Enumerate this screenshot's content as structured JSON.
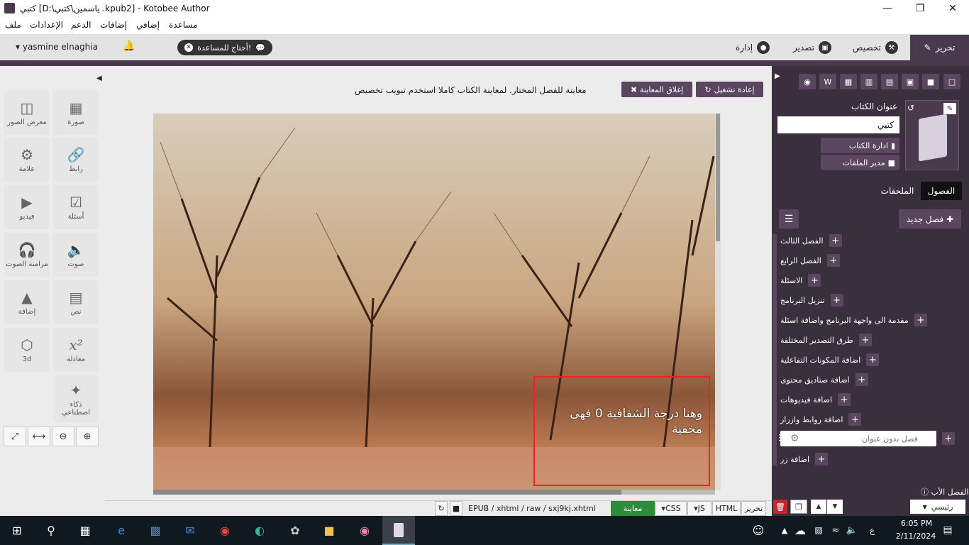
{
  "window": {
    "title": "كتبي [D:\\ياسمين\\كتبي .kpub2] - Kotobee Author"
  },
  "menu": [
    "ملف",
    "الإعدادات",
    "الدعم",
    "إضافات",
    "إضافي",
    "مساعدة"
  ],
  "header": {
    "user": "yasmine elnaghia",
    "help_button": "أحتاج للمساعدة!",
    "tabs": [
      "تحرير",
      "تخصيص",
      "تصدير",
      "إدارة"
    ]
  },
  "preview": {
    "notice": "معاينة للفصل المختار. لمعاينة الكتاب كاملا استخدم تبويب تخصيص",
    "restart": "إعادة تشغيل",
    "close": "إغلاق المعاينة",
    "overlay_text": "وهنا درجة الشفافية 0 فهى مخفية"
  },
  "tools": [
    {
      "label": "صورة",
      "icon": "image-icon"
    },
    {
      "label": "معرض الصور",
      "icon": "gallery-icon"
    },
    {
      "label": "رابط",
      "icon": "link-icon"
    },
    {
      "label": "علامة",
      "icon": "marker-icon"
    },
    {
      "label": "أسئلة",
      "icon": "questions-icon"
    },
    {
      "label": "فيديو",
      "icon": "video-icon"
    },
    {
      "label": "صوت",
      "icon": "audio-icon"
    },
    {
      "label": "مزامنة الصوت",
      "icon": "audio-sync-icon"
    },
    {
      "label": "نص",
      "icon": "text-icon"
    },
    {
      "label": "إضافة",
      "icon": "widget-icon"
    },
    {
      "label": "معادلة",
      "icon": "equation-icon"
    },
    {
      "label": "3d",
      "icon": "cube-icon"
    },
    {
      "label": "ذكاء اصطناعي",
      "icon": "ai-wand-icon"
    }
  ],
  "bottom": {
    "path": "EPUB / xhtml / raw / sxj9kj.xhtml",
    "preview": "معاينة",
    "css": "CSS",
    "js": "JS",
    "html": "HTML",
    "edit": "تحرير"
  },
  "book": {
    "title_label": "عنوان الكتاب",
    "title_value": "كتبي",
    "manage": "ادارة الكتاب",
    "files": "مدير الملفات"
  },
  "right_tabs": {
    "chapters": "الفصول",
    "appendices": "الملحقات"
  },
  "new_chapter": "فصل جديد",
  "chapters": [
    "الفصل الثالث",
    "الفصل الرابع",
    "الاسئلة",
    "تنزيل البرنامج",
    "مقدمة الى واجهة البرنامج واضافة اسئلة",
    "طرق التصدير المختلفة",
    "اضافة المكونات التفاعلية",
    "اضافة صناديق محتوى",
    "اضافة فيديوهات",
    "اضافة روابط وازرار"
  ],
  "chapter_input_placeholder": "فصل بدون عنوان",
  "last_chapter": "اضافة زر",
  "parent_label": "الفصل الأب",
  "parent_value": "رئيسي",
  "taskbar": {
    "time": "6:05 PM",
    "date": "2/11/2024",
    "lang": "ع"
  }
}
